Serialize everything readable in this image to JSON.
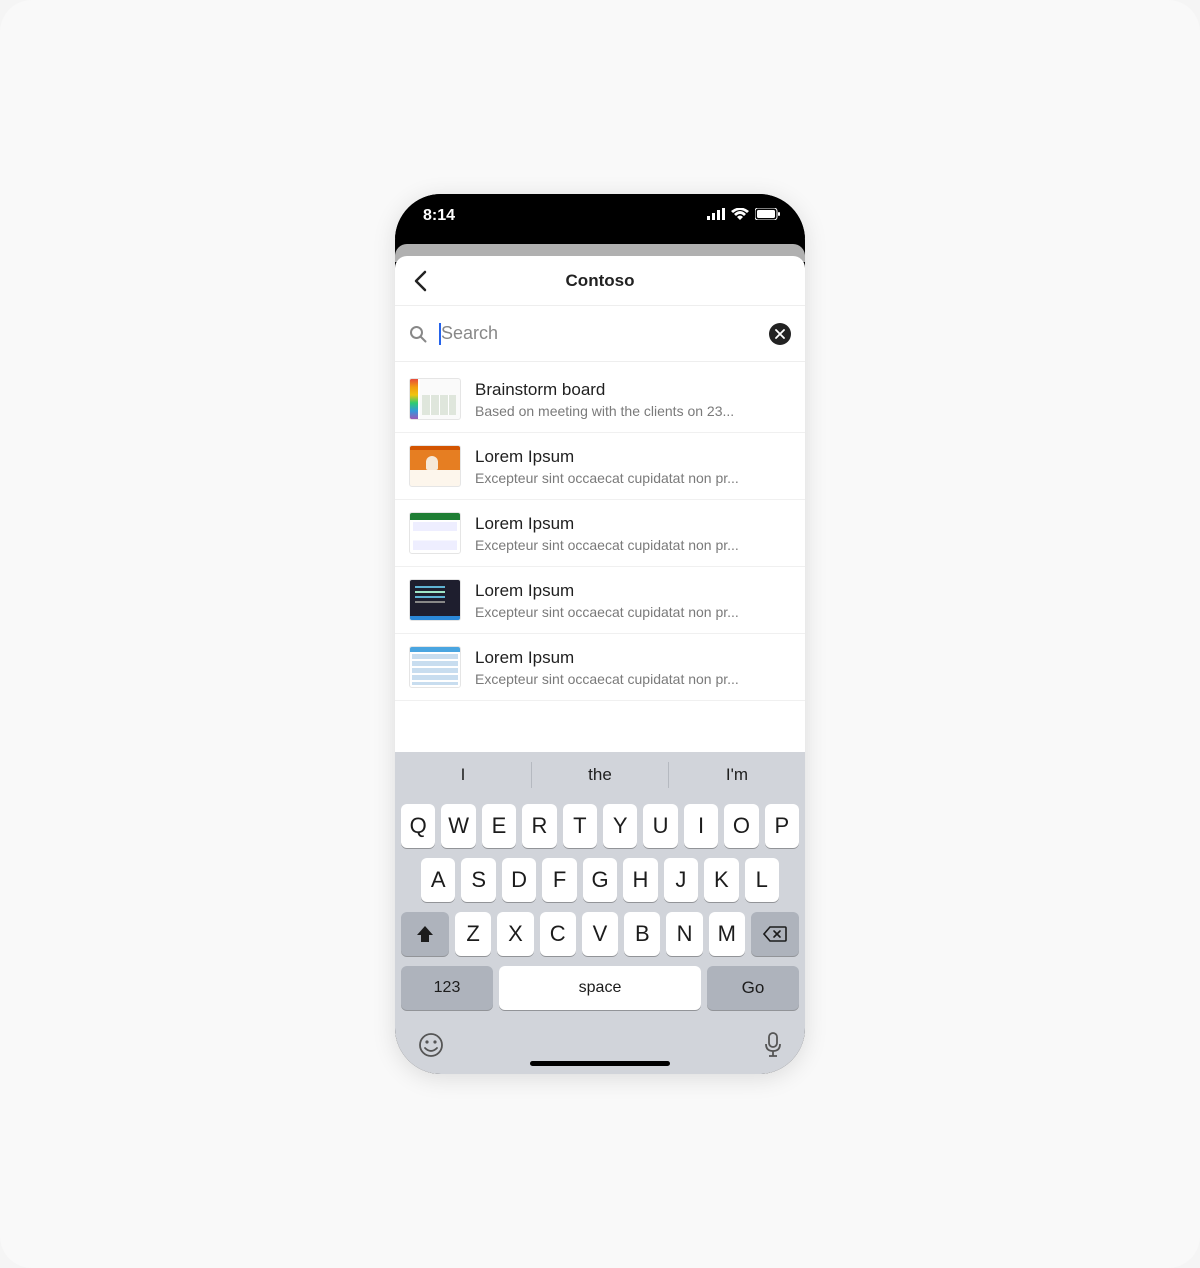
{
  "status": {
    "time": "8:14"
  },
  "header": {
    "title": "Contoso"
  },
  "search": {
    "placeholder": "Search",
    "value": ""
  },
  "results": [
    {
      "title": "Brainstorm board",
      "subtitle": "Based on meeting with the clients on 23...",
      "thumbClass": "thumb-rainbow"
    },
    {
      "title": "Lorem Ipsum",
      "subtitle": "Excepteur sint occaecat cupidatat non pr...",
      "thumbClass": "thumb-orange"
    },
    {
      "title": "Lorem Ipsum",
      "subtitle": "Excepteur sint occaecat cupidatat non pr...",
      "thumbClass": "thumb-excel"
    },
    {
      "title": "Lorem Ipsum",
      "subtitle": "Excepteur sint occaecat cupidatat non pr...",
      "thumbClass": "thumb-code"
    },
    {
      "title": "Lorem Ipsum",
      "subtitle": "Excepteur sint occaecat cupidatat non pr...",
      "thumbClass": "thumb-table"
    }
  ],
  "keyboard": {
    "suggestions": [
      "I",
      "the",
      "I'm"
    ],
    "row1": [
      "Q",
      "W",
      "E",
      "R",
      "T",
      "Y",
      "U",
      "I",
      "O",
      "P"
    ],
    "row2": [
      "A",
      "S",
      "D",
      "F",
      "G",
      "H",
      "J",
      "K",
      "L"
    ],
    "row3": [
      "Z",
      "X",
      "C",
      "V",
      "B",
      "N",
      "M"
    ],
    "numKey": "123",
    "spaceKey": "space",
    "goKey": "Go"
  }
}
